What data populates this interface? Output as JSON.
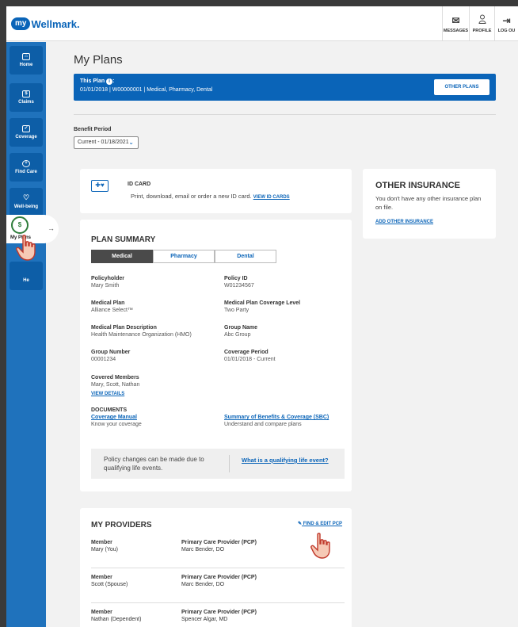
{
  "header": {
    "logo_my": "my",
    "logo_text": "Wellmark.",
    "buttons": {
      "messages": "MESSAGES",
      "profile": "PROFILE",
      "logout": "LOG OU"
    }
  },
  "sidebar": {
    "items": [
      {
        "label": "Home",
        "icon": "home-icon"
      },
      {
        "label": "Claims",
        "icon": "claims-icon"
      },
      {
        "label": "Coverage",
        "icon": "coverage-icon"
      },
      {
        "label": "Find Care",
        "icon": "find-care-icon"
      },
      {
        "label": "Well-being",
        "icon": "heart-icon"
      },
      {
        "label": "My Plans",
        "icon": "my-plans-icon"
      },
      {
        "label": "He",
        "icon": "help-icon"
      }
    ]
  },
  "main": {
    "title": "My Plans",
    "plan_banner": {
      "title": "This Plan",
      "details": "01/01/2018 | W00000001 | Medical, Pharmacy, Dental",
      "other_plans": "OTHER PLANS"
    },
    "benefit_period": {
      "label": "Benefit Period",
      "value": "Current - 01/18/2021"
    },
    "id_card": {
      "title": "ID CARD",
      "text": "Print, download, email or order a new ID card.",
      "link": "VIEW ID CARDS"
    },
    "other_insurance": {
      "title": "OTHER INSURANCE",
      "text": "You don't have any other insurance plan on file.",
      "link": "ADD OTHER INSURANCE"
    },
    "plan_summary": {
      "title": "PLAN SUMMARY",
      "tabs": [
        "Medical",
        "Pharmacy",
        "Dental"
      ],
      "fields": {
        "policyholder": {
          "label": "Policyholder",
          "value": "Mary Smith"
        },
        "policy_id": {
          "label": "Policy ID",
          "value": "W01234567"
        },
        "medical_plan": {
          "label": "Medical Plan",
          "value": "Alliance Select™"
        },
        "coverage_level": {
          "label": "Medical Plan Coverage Level",
          "value": "Two Party"
        },
        "plan_description": {
          "label": "Medical Plan Description",
          "value": "Health Maintenance Organization (HMO)"
        },
        "group_name": {
          "label": "Group Name",
          "value": "Abc Group"
        },
        "group_number": {
          "label": "Group Number",
          "value": "00001234"
        },
        "coverage_period": {
          "label": "Coverage Period",
          "value": "01/01/2018 - Current"
        },
        "covered_members": {
          "label": "Covered Members",
          "value": "Mary, Scott, Nathan",
          "link": "VIEW DETAILS"
        }
      },
      "documents": {
        "label": "DOCUMENTS",
        "coverage_manual": {
          "link": "Coverage Manual",
          "sub": "Know your coverage"
        },
        "sbc": {
          "link": "Summary of Benefits & Coverage (SBC)",
          "sub": "Understand and compare plans"
        }
      },
      "qualifying": {
        "text": "Policy changes can be made due to qualifying life events.",
        "link": "What is a qualifying life event?"
      }
    },
    "providers": {
      "title": "MY PROVIDERS",
      "find_edit": "FIND & EDIT PCP",
      "rows": [
        {
          "member_label": "Member",
          "member": "Mary (You)",
          "pcp_label": "Primary Care Provider (PCP)",
          "pcp": "Marc Bender, DO"
        },
        {
          "member_label": "Member",
          "member": "Scott (Spouse)",
          "pcp_label": "Primary Care Provider (PCP)",
          "pcp": "Marc Bender, DO"
        },
        {
          "member_label": "Member",
          "member": "Nathan (Dependent)",
          "pcp_label": "Primary Care Provider (PCP)",
          "pcp": "Spencer Algar, MD"
        }
      ]
    }
  },
  "colors": {
    "brand_blue": "#0a64b8",
    "sidebar_blue": "#1f72bc",
    "active_tab": "#4a4a4a",
    "cursor_fill": "#f6c9b5",
    "cursor_outline": "#c0392b"
  }
}
